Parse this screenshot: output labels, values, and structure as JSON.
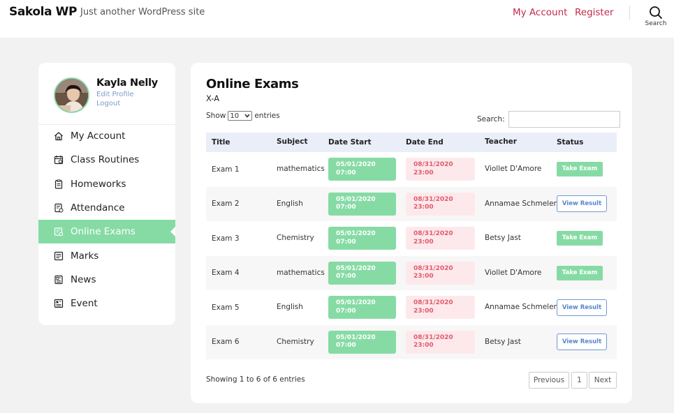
{
  "header": {
    "site_title": "Sakola WP",
    "tagline": "Just another WordPress site",
    "nav": {
      "my_account": "My Account",
      "register": "Register"
    },
    "search_label": "Search"
  },
  "profile": {
    "name": "Kayla Nelly",
    "edit_profile": "Edit Profile",
    "logout": "Logout"
  },
  "menu": [
    {
      "label": "My Account",
      "icon": "home-icon"
    },
    {
      "label": "Class Routines",
      "icon": "calendar-icon"
    },
    {
      "label": "Homeworks",
      "icon": "clipboard-icon"
    },
    {
      "label": "Attendance",
      "icon": "attendance-icon"
    },
    {
      "label": "Online Exams",
      "icon": "exam-icon",
      "active": true
    },
    {
      "label": "Marks",
      "icon": "marks-icon"
    },
    {
      "label": "News",
      "icon": "news-icon"
    },
    {
      "label": "Event",
      "icon": "event-icon"
    }
  ],
  "exams": {
    "title": "Online Exams",
    "class": "X-A",
    "show_label": "Show",
    "entries_value": "10",
    "entries_label": "entries",
    "search_label": "Search:",
    "columns": [
      "Title",
      "Subject",
      "Date Start",
      "Date End",
      "Teacher",
      "Status"
    ],
    "rows": [
      {
        "title": "Exam 1",
        "subject": "mathematics",
        "start": "05/01/2020 07:00",
        "end": "08/31/2020 23:00",
        "teacher": "Viollet D'Amore",
        "status": "Take Exam"
      },
      {
        "title": "Exam 2",
        "subject": "English",
        "start": "05/01/2020 07:00",
        "end": "08/31/2020 23:00",
        "teacher": "Annamae Schmeler",
        "status": "View Result"
      },
      {
        "title": "Exam 3",
        "subject": "Chemistry",
        "start": "05/01/2020 07:00",
        "end": "08/31/2020 23:00",
        "teacher": "Betsy Jast",
        "status": "Take Exam"
      },
      {
        "title": "Exam 4",
        "subject": "mathematics",
        "start": "05/01/2020 07:00",
        "end": "08/31/2020 23:00",
        "teacher": "Viollet D'Amore",
        "status": "Take Exam"
      },
      {
        "title": "Exam 5",
        "subject": "English",
        "start": "05/01/2020 07:00",
        "end": "08/31/2020 23:00",
        "teacher": "Annamae Schmeler",
        "status": "View Result"
      },
      {
        "title": "Exam 6",
        "subject": "Chemistry",
        "start": "05/01/2020 07:00",
        "end": "08/31/2020 23:00",
        "teacher": "Betsy Jast",
        "status": "View Result"
      }
    ],
    "info": "Showing 1 to 6 of 6 entries",
    "pagination": {
      "previous": "Previous",
      "page": "1",
      "next": "Next"
    }
  },
  "colors": {
    "accent_green": "#86dba5",
    "link_red": "#c42a4a",
    "end_date_bg": "#fde9ec",
    "end_date_text": "#e05a6a",
    "result_blue": "#5a86c9"
  }
}
